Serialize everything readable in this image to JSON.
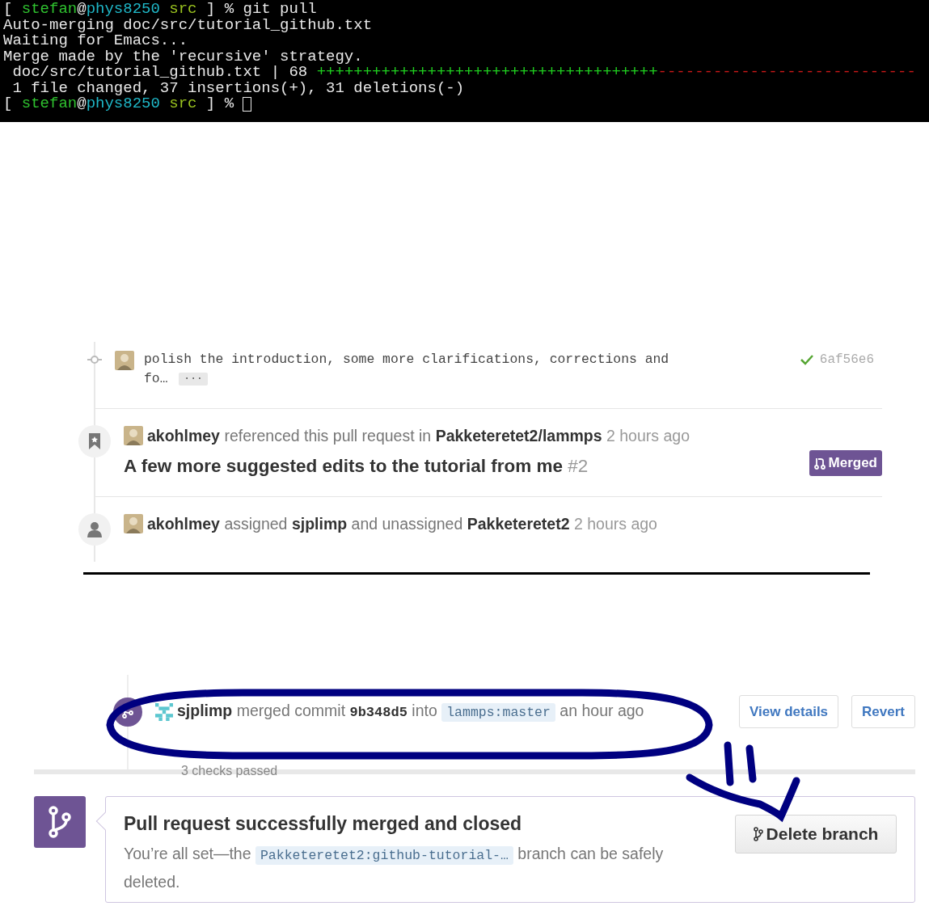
{
  "terminal": {
    "lines": [
      {
        "segments": [
          {
            "kind": "plain",
            "text": "[ "
          },
          {
            "kind": "user",
            "text": "stefan"
          },
          {
            "kind": "plain",
            "text": "@"
          },
          {
            "kind": "host",
            "text": "phys8250"
          },
          {
            "kind": "dir",
            "text": " src"
          },
          {
            "kind": "plain",
            "text": " ] % git pull"
          }
        ],
        "cursor": false
      },
      {
        "segments": [
          {
            "kind": "plain",
            "text": "Auto-merging doc/src/tutorial_github.txt"
          }
        ],
        "cursor": false
      },
      {
        "segments": [
          {
            "kind": "plain",
            "text": "Waiting for Emacs..."
          }
        ],
        "cursor": false
      },
      {
        "segments": [
          {
            "kind": "plain",
            "text": "Merge made by the 'recursive' strategy."
          }
        ],
        "cursor": false
      },
      {
        "segments": [
          {
            "kind": "plain",
            "text": " doc/src/tutorial_github.txt | 68 "
          },
          {
            "kind": "added",
            "text": "+++++++++++++++++++++++++++++++++++++"
          },
          {
            "kind": "removed",
            "text": "----------------------------"
          }
        ],
        "cursor": false
      },
      {
        "segments": [
          {
            "kind": "plain",
            "text": " 1 file changed, 37 insertions(+), 31 deletions(-)"
          }
        ],
        "cursor": false
      },
      {
        "segments": [
          {
            "kind": "plain",
            "text": "[ "
          },
          {
            "kind": "user",
            "text": "stefan"
          },
          {
            "kind": "plain",
            "text": "@"
          },
          {
            "kind": "host",
            "text": "phys8250"
          },
          {
            "kind": "dir",
            "text": " src"
          },
          {
            "kind": "plain",
            "text": " ] % "
          }
        ],
        "cursor": true
      }
    ]
  },
  "timeline": {
    "commit": {
      "message": "polish the introduction, some more clarifications, corrections and fo…",
      "expander": "···",
      "checks_passed": true,
      "sha": "6af56e6"
    },
    "events": [
      {
        "kind": "reference",
        "text": "**akohlmey** referenced this pull request in **Pakketeretet2/lammps**",
        "time": "2 hours ago",
        "title": "A few more suggested edits to the tutorial from me",
        "number": "#2",
        "badge": "Merged"
      },
      {
        "kind": "assignment",
        "text": "**akohlmey** assigned **sjplimp** and unassigned **Pakketeretet2**",
        "time": "2 hours ago"
      }
    ]
  },
  "merge": {
    "event": {
      "text": "**sjplimp** merged commit",
      "sha": "9b348d5",
      "into": "into",
      "branch": "lammps:master",
      "time": "an hour ago",
      "checks": "3 checks passed",
      "buttons": [
        "View details",
        "Revert"
      ]
    },
    "box": {
      "title": "Pull request successfully merged and closed",
      "before": "You’re all set—the",
      "branch": "Pakketeretet2:github-tutorial-…",
      "after": "branch can be safely deleted.",
      "button": "Delete branch"
    }
  }
}
